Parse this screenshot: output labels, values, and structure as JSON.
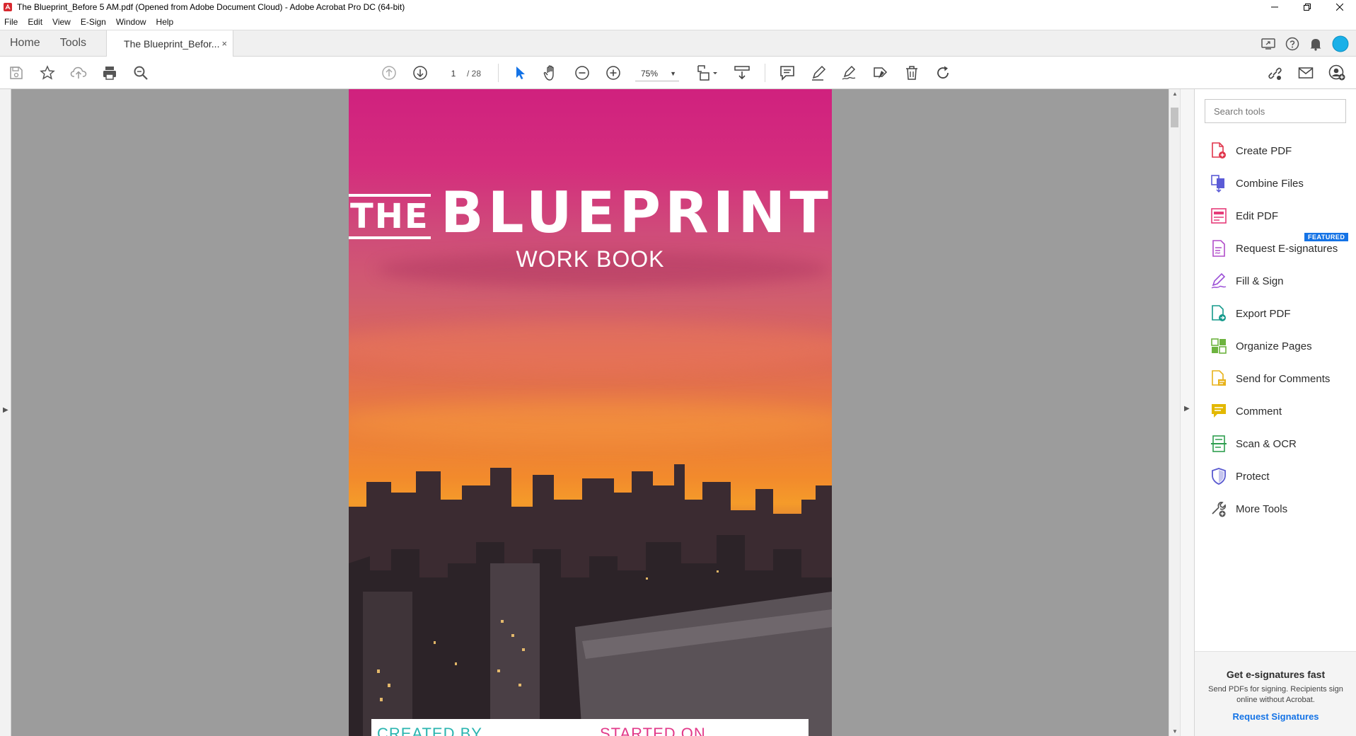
{
  "window": {
    "title": "The Blueprint_Before 5 AM.pdf (Opened from Adobe Document Cloud) - Adobe Acrobat Pro DC (64-bit)"
  },
  "menu": [
    "File",
    "Edit",
    "View",
    "E-Sign",
    "Window",
    "Help"
  ],
  "tabs": {
    "home": "Home",
    "tools": "Tools",
    "document": "The Blueprint_Befor...",
    "close": "×"
  },
  "toolbar": {
    "page_current": "1",
    "page_total": "/ 28",
    "zoom": "75%"
  },
  "document_page": {
    "headline_the": "THE",
    "headline_main": "BLUEPRINT",
    "subtitle": "WORK BOOK",
    "footer_left": "CREATED BY",
    "footer_right": "STARTED ON",
    "footer_left_color": "#2bb5b0",
    "footer_right_color": "#e23a8a"
  },
  "tools_pane": {
    "search_placeholder": "Search tools",
    "featured_badge": "FEATURED",
    "items": [
      {
        "label": "Create PDF",
        "icon": "create-pdf-icon",
        "color": "#e0344a"
      },
      {
        "label": "Combine Files",
        "icon": "combine-files-icon",
        "color": "#5b5bd6"
      },
      {
        "label": "Edit PDF",
        "icon": "edit-pdf-icon",
        "color": "#e63c7a"
      },
      {
        "label": "Request E-signatures",
        "icon": "request-esignatures-icon",
        "color": "#b14dc9"
      },
      {
        "label": "Fill & Sign",
        "icon": "fill-sign-icon",
        "color": "#9b4fd6"
      },
      {
        "label": "Export PDF",
        "icon": "export-pdf-icon",
        "color": "#159a8c"
      },
      {
        "label": "Organize Pages",
        "icon": "organize-pages-icon",
        "color": "#6db33f"
      },
      {
        "label": "Send for Comments",
        "icon": "send-for-comments-icon",
        "color": "#e8b21a"
      },
      {
        "label": "Comment",
        "icon": "comment-icon",
        "color": "#e3b800"
      },
      {
        "label": "Scan & OCR",
        "icon": "scan-ocr-icon",
        "color": "#2e9e4f"
      },
      {
        "label": "Protect",
        "icon": "protect-icon",
        "color": "#5a5ad0"
      },
      {
        "label": "More Tools",
        "icon": "more-tools-icon",
        "color": "#555555"
      }
    ],
    "promo": {
      "heading": "Get e-signatures fast",
      "body": "Send PDFs for signing. Recipients sign online without Acrobat.",
      "link": "Request Signatures"
    }
  },
  "colors": {
    "accent": "#1473e6",
    "select_tool": "#1473e6"
  }
}
